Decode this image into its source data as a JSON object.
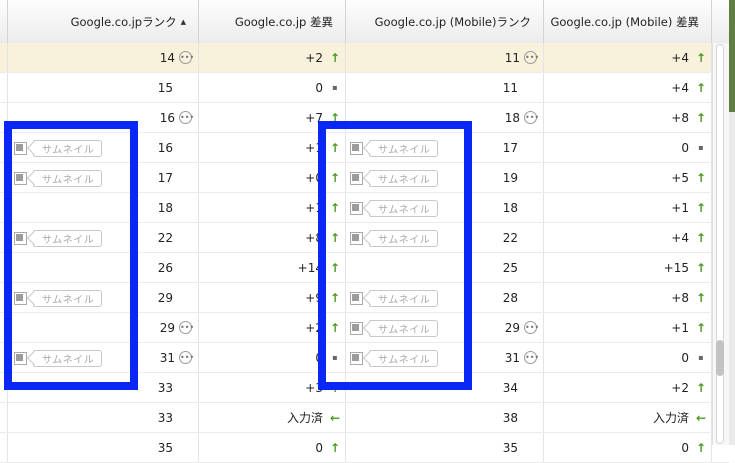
{
  "header": {
    "col_rank": "Google.co.jpランク",
    "col_diff": "Google.co.jp 差異",
    "col_mrank": "Google.co.jp (Mobile)ランク",
    "col_mdiff": "Google.co.jp (Mobile) 差異",
    "sort_indicator": "▲"
  },
  "thumbnail_label": "サムネイル",
  "rows": [
    {
      "rank": "14",
      "rank_more": true,
      "diff": "+2",
      "diff_dir": "up",
      "thumb1": false,
      "mrank": "11",
      "mrank_more": true,
      "mdiff": "+4",
      "mdiff_dir": "up",
      "thumb2": false
    },
    {
      "rank": "15",
      "rank_more": false,
      "diff": "0",
      "diff_dir": "flat",
      "thumb1": false,
      "mrank": "11",
      "mrank_more": false,
      "mdiff": "+4",
      "mdiff_dir": "up",
      "thumb2": false
    },
    {
      "rank": "16",
      "rank_more": true,
      "diff": "+7",
      "diff_dir": "up",
      "thumb1": false,
      "mrank": "18",
      "mrank_more": true,
      "mdiff": "+8",
      "mdiff_dir": "up",
      "thumb2": false
    },
    {
      "rank": "16",
      "rank_more": false,
      "diff": "+1",
      "diff_dir": "up",
      "thumb1": true,
      "mrank": "17",
      "mrank_more": false,
      "mdiff": "0",
      "mdiff_dir": "flat",
      "thumb2": true
    },
    {
      "rank": "17",
      "rank_more": false,
      "diff": "+0",
      "diff_dir": "up",
      "thumb1": true,
      "mrank": "19",
      "mrank_more": false,
      "mdiff": "+5",
      "mdiff_dir": "up",
      "thumb2": true
    },
    {
      "rank": "18",
      "rank_more": false,
      "diff": "+1",
      "diff_dir": "up",
      "thumb1": false,
      "mrank": "18",
      "mrank_more": false,
      "mdiff": "+1",
      "mdiff_dir": "up",
      "thumb2": true
    },
    {
      "rank": "22",
      "rank_more": false,
      "diff": "+8",
      "diff_dir": "up",
      "thumb1": true,
      "mrank": "22",
      "mrank_more": false,
      "mdiff": "+4",
      "mdiff_dir": "up",
      "thumb2": true
    },
    {
      "rank": "26",
      "rank_more": false,
      "diff": "+14",
      "diff_dir": "up",
      "thumb1": false,
      "mrank": "25",
      "mrank_more": false,
      "mdiff": "+15",
      "mdiff_dir": "up",
      "thumb2": false
    },
    {
      "rank": "29",
      "rank_more": false,
      "diff": "+9",
      "diff_dir": "up",
      "thumb1": true,
      "mrank": "28",
      "mrank_more": false,
      "mdiff": "+8",
      "mdiff_dir": "up",
      "thumb2": true
    },
    {
      "rank": "29",
      "rank_more": true,
      "diff": "+2",
      "diff_dir": "up",
      "thumb1": false,
      "mrank": "29",
      "mrank_more": true,
      "mdiff": "+1",
      "mdiff_dir": "up",
      "thumb2": true
    },
    {
      "rank": "31",
      "rank_more": true,
      "diff": "0",
      "diff_dir": "flat",
      "thumb1": true,
      "mrank": "31",
      "mrank_more": true,
      "mdiff": "0",
      "mdiff_dir": "flat",
      "thumb2": true
    },
    {
      "rank": "33",
      "rank_more": false,
      "diff": "+3",
      "diff_dir": "up",
      "thumb1": false,
      "mrank": "34",
      "mrank_more": false,
      "mdiff": "+2",
      "mdiff_dir": "up",
      "thumb2": false
    },
    {
      "rank": "33",
      "rank_more": false,
      "diff": "入力済",
      "diff_dir": "left",
      "thumb1": false,
      "mrank": "38",
      "mrank_more": false,
      "mdiff": "入力済",
      "mdiff_dir": "left",
      "thumb2": false
    },
    {
      "rank": "35",
      "rank_more": false,
      "diff": "0",
      "diff_dir": "up",
      "thumb1": false,
      "mrank": "35",
      "mrank_more": false,
      "mdiff": "0",
      "mdiff_dir": "up",
      "thumb2": false
    }
  ],
  "colors": {
    "highlight_row": "#f8f1dc",
    "up_arrow": "#4c9a22",
    "annotation_box": "#0a28f5",
    "edge_bar": "#5e7f43"
  },
  "icons": {
    "more": "more-options-icon",
    "up": "arrow-up-icon",
    "flat": "unchanged-icon",
    "left": "arrow-left-icon",
    "thumb": "thumbnail-icon"
  }
}
